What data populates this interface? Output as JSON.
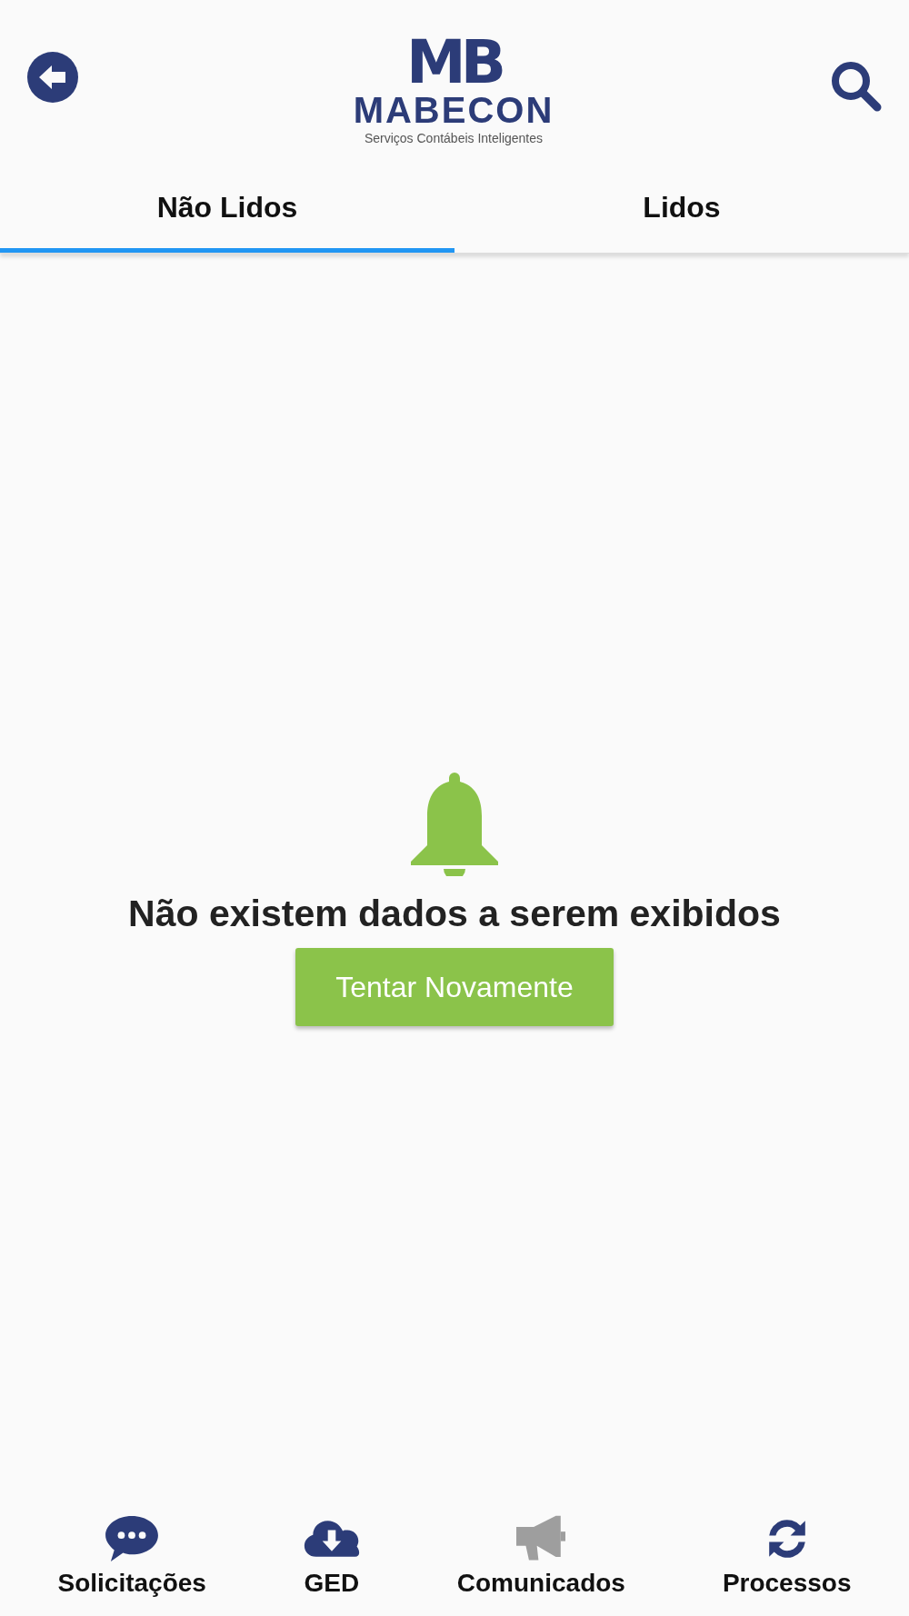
{
  "header": {
    "logo_mark": "MB",
    "logo_name": "MABECON",
    "logo_tagline": "Serviços Contábeis Inteligentes"
  },
  "tabs": [
    {
      "label": "Não Lidos",
      "selected": true
    },
    {
      "label": "Lidos",
      "selected": false
    }
  ],
  "empty_state": {
    "message": "Não existem dados a serem exibidos",
    "button": "Tentar Novamente"
  },
  "bottom_nav": [
    {
      "label": "Solicitações",
      "kind": "chat",
      "selected": false
    },
    {
      "label": "GED",
      "kind": "download",
      "selected": false
    },
    {
      "label": "Comunicados",
      "kind": "megaphone",
      "selected": true
    },
    {
      "label": "Processos",
      "kind": "sync",
      "selected": false
    }
  ]
}
